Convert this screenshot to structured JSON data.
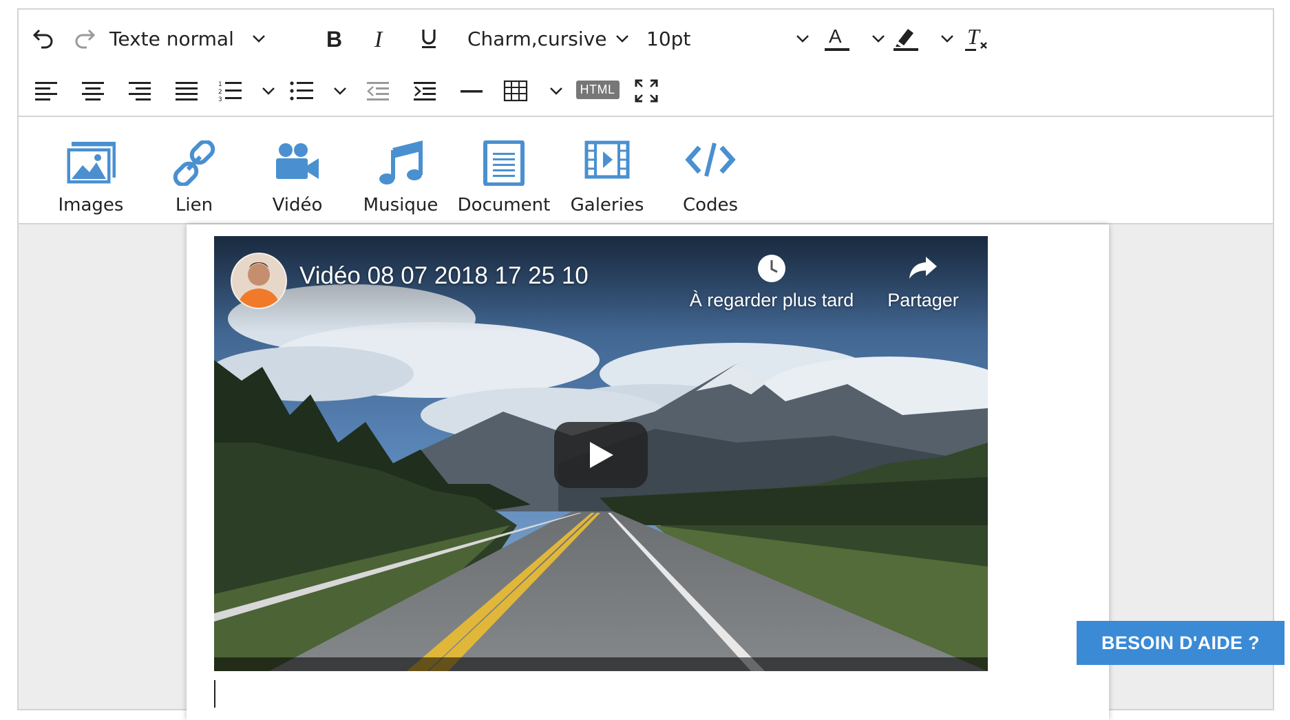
{
  "toolbar": {
    "paragraph_style": "Texte normal",
    "font_family": "Charm,cursive",
    "font_size": "10pt",
    "html_label": "HTML"
  },
  "inserts": [
    {
      "label": "Images",
      "icon": "image-icon"
    },
    {
      "label": "Lien",
      "icon": "link-icon"
    },
    {
      "label": "Vidéo",
      "icon": "video-camera-icon"
    },
    {
      "label": "Musique",
      "icon": "music-icon"
    },
    {
      "label": "Document",
      "icon": "document-icon"
    },
    {
      "label": "Galeries",
      "icon": "film-gallery-icon"
    },
    {
      "label": "Codes",
      "icon": "code-icon"
    }
  ],
  "video": {
    "title": "Vidéo 08 07 2018 17 25 10",
    "watch_later": "À regarder plus tard",
    "share": "Partager"
  },
  "help_button": "BESOIN D'AIDE ?",
  "colors": {
    "accent_blue": "#4a90d0",
    "help_bg": "#3a8ad6",
    "border": "#d4d4d4"
  }
}
